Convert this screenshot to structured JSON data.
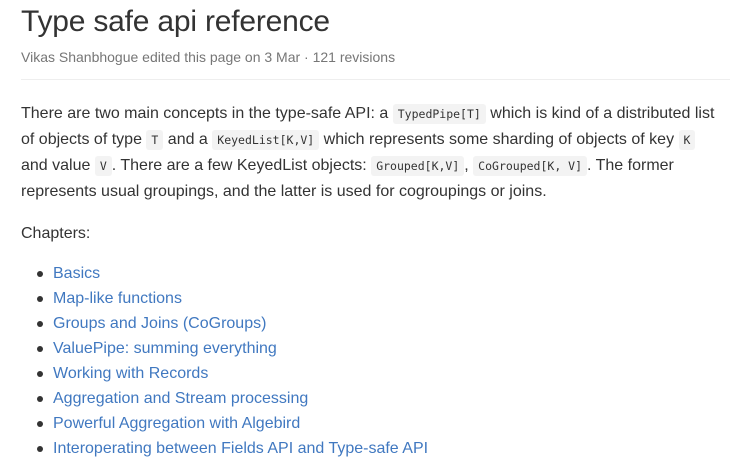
{
  "page": {
    "title": "Type safe api reference",
    "meta": "Vikas Shanbhogue edited this page on 3 Mar · 121 revisions"
  },
  "intro": {
    "t1": "There are two main concepts in the type-safe API: a ",
    "c1": "TypedPipe[T]",
    "t2": " which is kind of a distributed list of objects of type ",
    "c2": "T",
    "t3": " and a ",
    "c3": "KeyedList[K,V]",
    "t4": " which represents some sharding of objects of key ",
    "c4": "K",
    "t5": " and value ",
    "c5": "V",
    "t6": ". There are a few KeyedList objects: ",
    "c6": "Grouped[K,V]",
    "t7": ", ",
    "c7": "CoGrouped[K, V]",
    "t8": ". The former represents usual groupings, and the latter is used for cogroupings or joins."
  },
  "chapters": {
    "label": "Chapters:",
    "items": [
      "Basics",
      "Map-like functions",
      "Groups and Joins (CoGroups)",
      "ValuePipe: summing everything",
      "Working with Records",
      "Aggregation and Stream processing",
      "Powerful Aggregation with Algebird",
      "Interoperating between Fields API and Type-safe API"
    ]
  },
  "colors": {
    "text": "#333333",
    "meta": "#767676",
    "link": "#4078c0",
    "code_bg": "#f3f3f3",
    "divider": "#eeeeee"
  }
}
